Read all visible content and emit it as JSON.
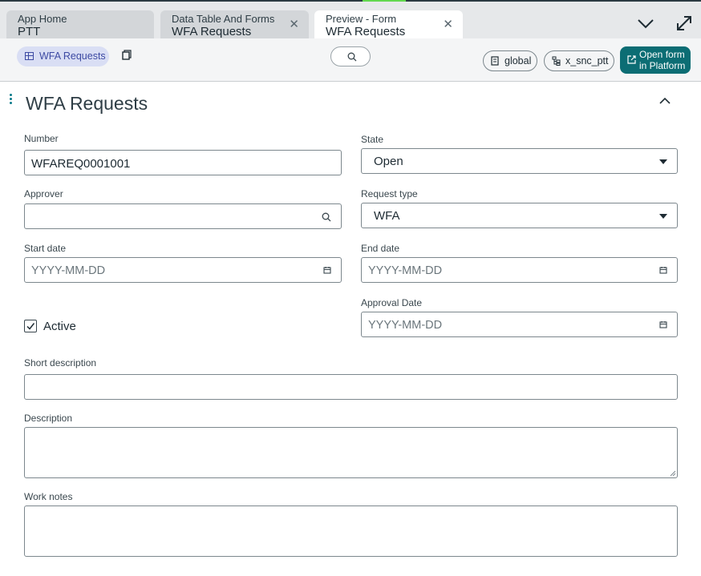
{
  "tabs": [
    {
      "line1": "App Home",
      "line2": "PTT"
    },
    {
      "line1": "Data Table And Forms",
      "line2": "WFA Requests"
    },
    {
      "line1": "Preview - Form",
      "line2": "WFA Requests"
    }
  ],
  "toolbar": {
    "table_pill": "WFA Requests",
    "scope_chip": "global",
    "app_chip": "x_snc_ptt",
    "open_button_line1": "Open form",
    "open_button_line2": "in Platform"
  },
  "form": {
    "title": "WFA Requests",
    "number": {
      "label": "Number",
      "value": "WFAREQ0001001"
    },
    "state": {
      "label": "State",
      "value": "Open"
    },
    "approver": {
      "label": "Approver",
      "value": ""
    },
    "request_type": {
      "label": "Request type",
      "value": "WFA"
    },
    "start_date": {
      "label": "Start date",
      "placeholder": "YYYY-MM-DD"
    },
    "end_date": {
      "label": "End date",
      "placeholder": "YYYY-MM-DD"
    },
    "approval_date": {
      "label": "Approval Date",
      "placeholder": "YYYY-MM-DD"
    },
    "active": {
      "label": "Active",
      "checked": true
    },
    "short_description": {
      "label": "Short description",
      "value": ""
    },
    "description": {
      "label": "Description",
      "value": ""
    },
    "work_notes": {
      "label": "Work notes",
      "value": ""
    }
  },
  "colors": {
    "accent": "#0c6d74",
    "table_pill_bg": "#d9def4",
    "tab_bar": "#e6e8ea"
  },
  "icons": [
    "table-icon",
    "copy-icon",
    "search-icon",
    "scope-icon",
    "app-tree-icon",
    "external-link-icon",
    "chevron-down-icon",
    "expand-icon",
    "calendar-icon",
    "chevron-up-icon",
    "more-options-icon"
  ]
}
